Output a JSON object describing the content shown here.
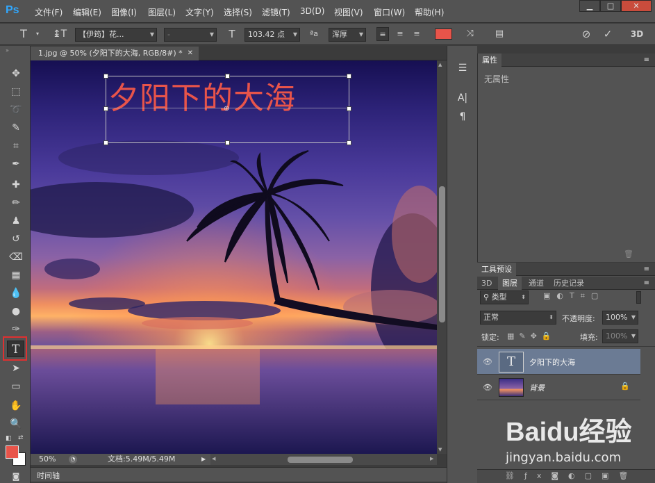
{
  "app": {
    "logo": "Ps"
  },
  "menu": [
    "文件(F)",
    "编辑(E)",
    "图像(I)",
    "图层(L)",
    "文字(Y)",
    "选择(S)",
    "滤镜(T)",
    "3D(D)",
    "视图(V)",
    "窗口(W)",
    "帮助(H)"
  ],
  "window_buttons": {
    "minimize": "▁",
    "maximize": "□",
    "close": "✕"
  },
  "options": {
    "font_family": "【伊筠】花...",
    "font_style": "-",
    "font_size": "103.42 点",
    "aa_label": "ªa",
    "antialias": "浑厚",
    "text_color": "#e8544a",
    "btn_3d": "3D"
  },
  "document": {
    "tab_title": "1.jpg @ 50% (夕阳下的大海, RGB/8#) *",
    "tab_close": "✕",
    "text_layer_content": "夕阳下的大海",
    "text_color": "#e8544a",
    "zoom": "50%",
    "doc_info": "文档:5.49M/5.49M"
  },
  "timeline": {
    "label": "时间轴"
  },
  "properties": {
    "title": "属性",
    "empty": "无属性"
  },
  "tool_presets": {
    "title": "工具预设"
  },
  "layers_panel": {
    "tabs": [
      "3D",
      "图层",
      "通道",
      "历史记录"
    ],
    "active_tab": "图层",
    "filter_kind": "类型",
    "blend_mode": "正常",
    "opacity_label": "不透明度:",
    "opacity": "100%",
    "lock_label": "锁定:",
    "fill_label": "填充:",
    "fill": "100%",
    "layers": [
      {
        "name": "夕阳下的大海",
        "type": "text",
        "selected": true
      },
      {
        "name": "背景",
        "type": "image",
        "locked": true
      }
    ]
  },
  "watermark": {
    "brand": "Baidu经验",
    "url": "jingyan.baidu.com"
  },
  "colors": {
    "foreground": "#e8544a",
    "background": "#ffffff",
    "highlight": "#e03030"
  }
}
